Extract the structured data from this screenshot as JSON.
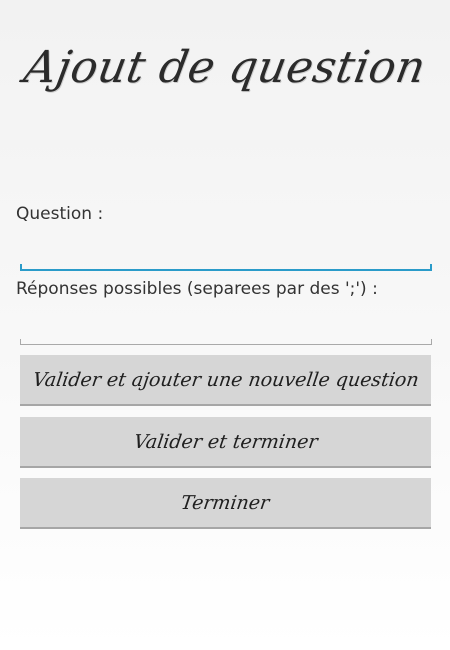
{
  "header": {
    "title": "Ajout de question"
  },
  "form": {
    "question_label": "Question :",
    "question_value": "",
    "answers_label": "Réponses possibles (separees par des ';') :",
    "answers_value": ""
  },
  "buttons": {
    "validate_add_label": "Valider et ajouter une nouvelle question",
    "validate_finish_label": "Valider et terminer",
    "finish_label": "Terminer"
  },
  "colors": {
    "focus_accent": "#2a9bc9",
    "button_bg": "#d6d6d6",
    "inactive_underline": "#a9a9a9"
  }
}
